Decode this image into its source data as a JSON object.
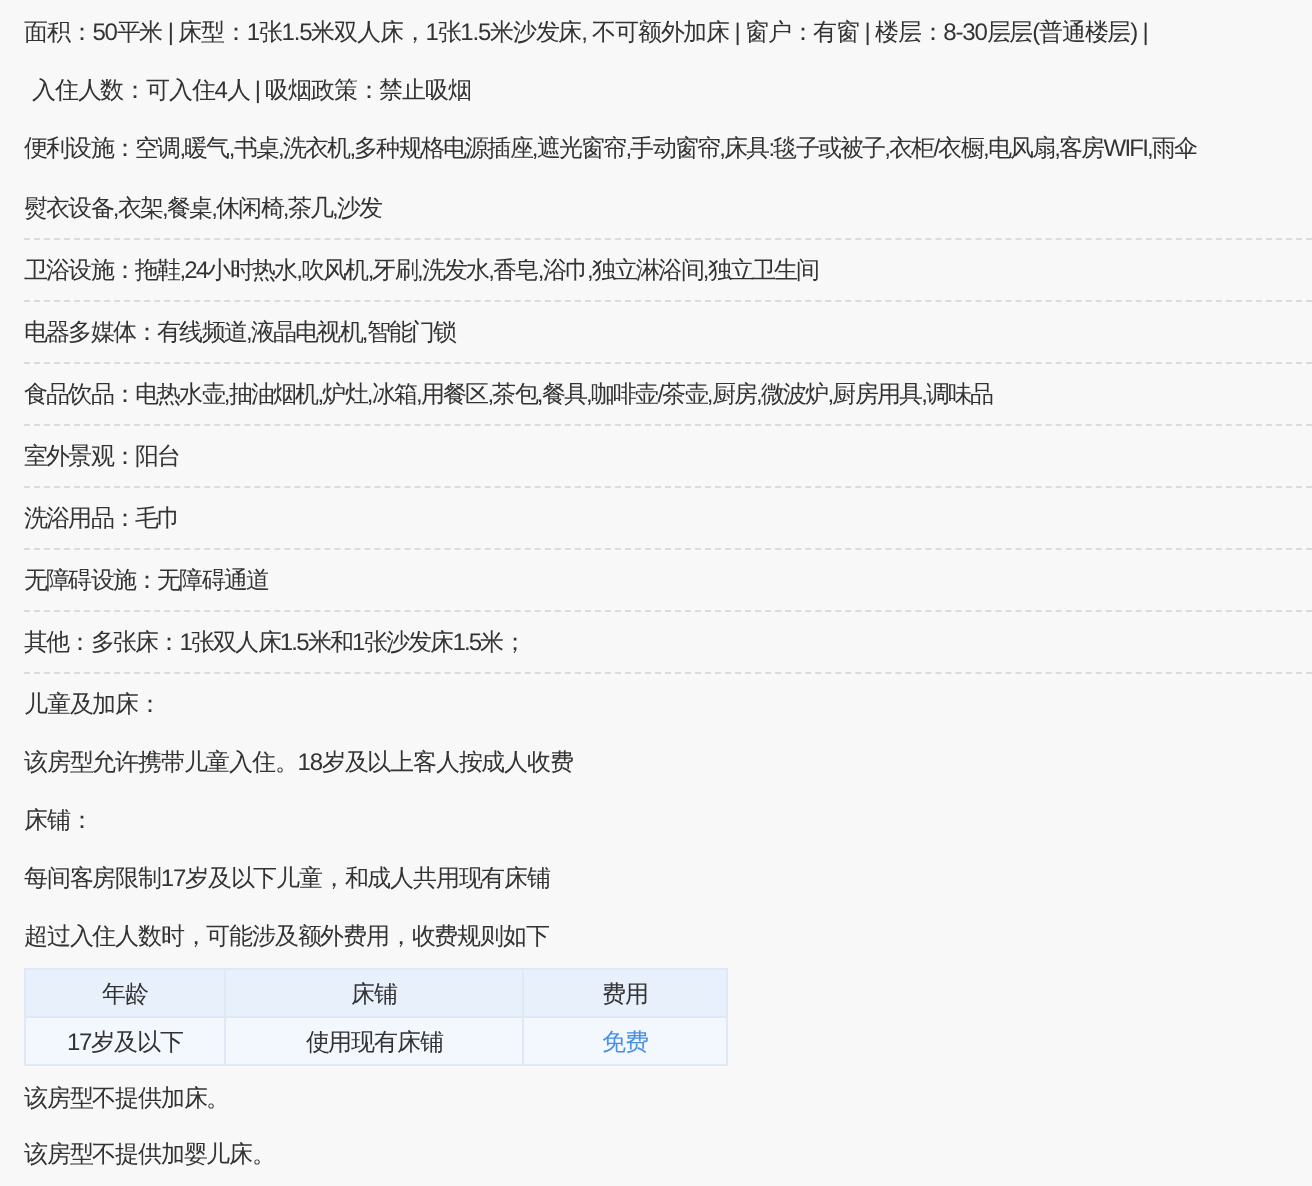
{
  "summary_lines": [
    "面积：50平米 | 床型：1张1.5米双人床，1张1.5米沙发床, 不可额外加床 | 窗户：有窗 | 楼层：8-30层层(普通楼层) |",
    "入住人数：可入住4人 | 吸烟政策：禁止吸烟"
  ],
  "facility_rows": [
    {
      "lines": [
        "便利设施：空调,暖气,书桌,洗衣机,多种规格电源插座,遮光窗帘,手动窗帘,床具:毯子或被子,衣柜/衣橱,电风扇,客房WIFI,雨伞",
        "熨衣设备,衣架,餐桌,休闲椅,茶几,沙发"
      ]
    },
    {
      "lines": [
        "卫浴设施：拖鞋,24小时热水,吹风机,牙刷,洗发水,香皂,浴巾,独立淋浴间,独立卫生间"
      ]
    },
    {
      "lines": [
        "电器多媒体：有线频道,液晶电视机,智能门锁"
      ]
    },
    {
      "lines": [
        "食品饮品：电热水壶,抽油烟机,炉灶,冰箱,用餐区,茶包,餐具,咖啡壶/茶壶,厨房,微波炉,厨房用具,调味品"
      ]
    },
    {
      "lines": [
        "室外景观：阳台"
      ]
    },
    {
      "lines": [
        "洗浴用品：毛巾"
      ]
    },
    {
      "lines": [
        "无障碍设施：无障碍通道"
      ]
    },
    {
      "lines": [
        "其他：多张床：1张双人床1.5米和1张沙发床1.5米；"
      ]
    }
  ],
  "policy_lines": [
    "儿童及加床：",
    "该房型允许携带儿童入住。18岁及以上客人按成人收费",
    "床铺：",
    "每间客房限制17岁及以下儿童，和成人共用现有床铺",
    "超过入住人数时，可能涉及额外费用，收费规则如下"
  ],
  "fee_table": {
    "columns": [
      "年龄",
      "床铺",
      "费用"
    ],
    "rows": [
      [
        {
          "text": "17岁及以下",
          "kind": "plain"
        },
        {
          "text": "使用现有床铺",
          "kind": "plain"
        },
        {
          "text": "免费",
          "kind": "highlight"
        }
      ]
    ]
  },
  "notes": [
    "该房型不提供加床。",
    "该房型不提供加婴儿床。"
  ]
}
